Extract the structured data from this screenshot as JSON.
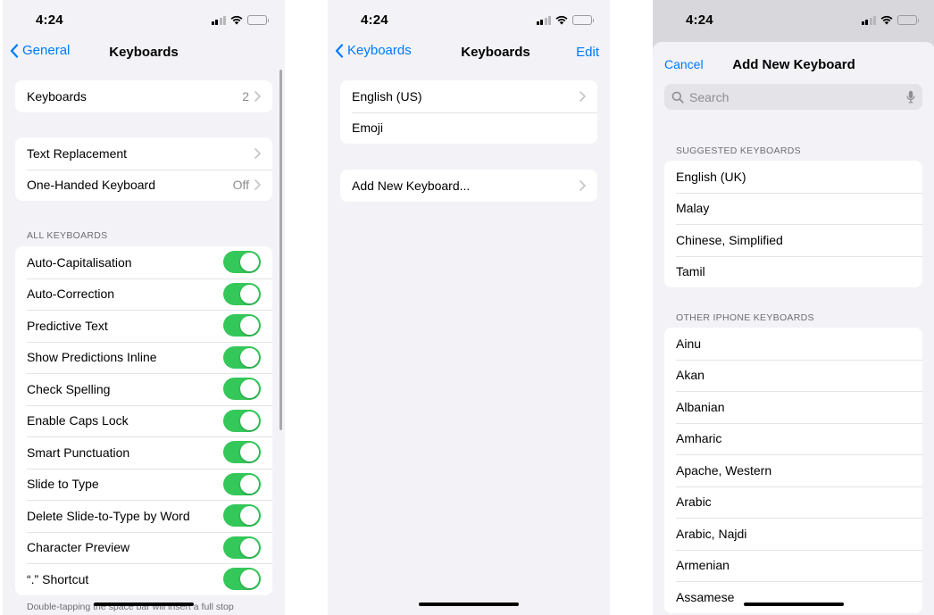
{
  "status_bar": {
    "time": "4:24"
  },
  "screen1": {
    "back_label": "General",
    "title": "Keyboards",
    "group1": [
      {
        "label": "Keyboards",
        "value": "2"
      }
    ],
    "group2": [
      {
        "label": "Text Replacement",
        "value": ""
      },
      {
        "label": "One-Handed Keyboard",
        "value": "Off"
      }
    ],
    "all_keyboards_header": "ALL KEYBOARDS",
    "toggles": [
      {
        "label": "Auto-Capitalisation",
        "on": true
      },
      {
        "label": "Auto-Correction",
        "on": true
      },
      {
        "label": "Predictive Text",
        "on": true
      },
      {
        "label": "Show Predictions Inline",
        "on": true
      },
      {
        "label": "Check Spelling",
        "on": true
      },
      {
        "label": "Enable Caps Lock",
        "on": true
      },
      {
        "label": "Smart Punctuation",
        "on": true
      },
      {
        "label": "Slide to Type",
        "on": true
      },
      {
        "label": "Delete Slide-to-Type by Word",
        "on": true
      },
      {
        "label": "Character Preview",
        "on": true
      },
      {
        "label": "“.” Shortcut",
        "on": true
      }
    ],
    "footer": "Double-tapping the space bar will insert a full stop"
  },
  "screen2": {
    "back_label": "Keyboards",
    "title": "Keyboards",
    "edit_label": "Edit",
    "keyboards": [
      {
        "label": "English (US)",
        "chevron": true
      },
      {
        "label": "Emoji",
        "chevron": false
      }
    ],
    "add_label": "Add New Keyboard..."
  },
  "screen3": {
    "cancel_label": "Cancel",
    "title": "Add New Keyboard",
    "search_placeholder": "Search",
    "suggested_header": "SUGGESTED KEYBOARDS",
    "suggested": [
      "English (UK)",
      "Malay",
      "Chinese, Simplified",
      "Tamil"
    ],
    "other_header": "OTHER IPHONE KEYBOARDS",
    "other": [
      "Ainu",
      "Akan",
      "Albanian",
      "Amharic",
      "Apache, Western",
      "Arabic",
      "Arabic, Najdi",
      "Armenian",
      "Assamese"
    ]
  },
  "colors": {
    "accent": "#007aff",
    "toggle_on": "#34c759",
    "battery": "#ffcc00",
    "background": "#f2f2f7"
  }
}
